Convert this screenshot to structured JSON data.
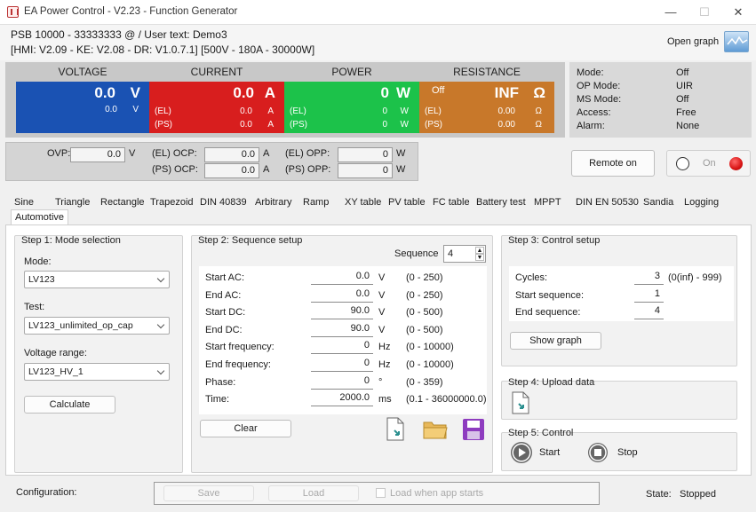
{
  "window": {
    "title": "EA Power Control - V2.23 - Function Generator",
    "minimize": "—",
    "maximize": "☐",
    "close": "✕"
  },
  "header": {
    "line1": "PSB 10000 - 33333333 @ / User text: Demo3",
    "line2": "[HMI: V2.09 - KE: V2.08 - DR: V1.0.7.1] [500V - 180A - 30000W]",
    "open_graph": "Open graph"
  },
  "meters": {
    "voltage": {
      "title": "VOLTAGE",
      "main": "0.0",
      "unit": "V",
      "sub": "0.0",
      "sub_unit": "V",
      "color": "#1a52b3"
    },
    "current": {
      "title": "CURRENT",
      "main": "0.0",
      "unit": "A",
      "el_label": "(EL)",
      "el_value": "0.0",
      "el_unit": "A",
      "ps_label": "(PS)",
      "ps_value": "0.0",
      "ps_unit": "A",
      "color": "#d81e1e"
    },
    "power": {
      "title": "POWER",
      "main": "0",
      "unit": "W",
      "el_label": "(EL)",
      "el_value": "0",
      "el_unit": "W",
      "ps_label": "(PS)",
      "ps_value": "0",
      "ps_unit": "W",
      "color": "#1cc24a"
    },
    "resistance": {
      "title": "RESISTANCE",
      "off": "Off",
      "main": "INF",
      "unit": "Ω",
      "el_label": "(EL)",
      "el_value": "0.00",
      "el_unit": "Ω",
      "ps_label": "(PS)",
      "ps_value": "0.00",
      "ps_unit": "Ω",
      "color": "#c8782a"
    }
  },
  "status_panel": [
    {
      "key": "Mode:",
      "value": "Off"
    },
    {
      "key": "OP Mode:",
      "value": "UIR"
    },
    {
      "key": "MS Mode:",
      "value": "Off"
    },
    {
      "key": "Access:",
      "value": "Free"
    },
    {
      "key": "Alarm:",
      "value": "None"
    }
  ],
  "protection": {
    "ovp_label": "OVP:",
    "ovp_value": "0.0",
    "ovp_unit": "V",
    "el_ocp_label": "(EL) OCP:",
    "el_ocp_value": "0.0",
    "el_ocp_unit": "A",
    "ps_ocp_label": "(PS) OCP:",
    "ps_ocp_value": "0.0",
    "ps_ocp_unit": "A",
    "el_opp_label": "(EL) OPP:",
    "el_opp_value": "0",
    "el_opp_unit": "W",
    "ps_opp_label": "(PS) OPP:",
    "ps_opp_value": "0",
    "ps_opp_unit": "W"
  },
  "remote_button": "Remote on",
  "output_toggle": {
    "label": "On",
    "indicator_color": "#e01c1c"
  },
  "tabs": [
    "Sine",
    "Triangle",
    "Rectangle",
    "Trapezoid",
    "DIN 40839",
    "Arbitrary",
    "Ramp",
    "XY table",
    "PV table",
    "FC table",
    "Battery test",
    "MPPT",
    "DIN EN 50530",
    "Sandia",
    "Logging",
    "Automotive"
  ],
  "step1": {
    "title": "Step 1: Mode selection",
    "mode_label": "Mode:",
    "mode_value": "LV123",
    "test_label": "Test:",
    "test_value": "LV123_unlimited_op_cap",
    "range_label": "Voltage range:",
    "range_value": "LV123_HV_1",
    "calculate": "Calculate"
  },
  "step2": {
    "title": "Step 2: Sequence setup",
    "sequence_label": "Sequence",
    "sequence_value": "4",
    "rows": [
      {
        "label": "Start AC:",
        "value": "0.0",
        "unit": "V",
        "range": "(0 - 250)"
      },
      {
        "label": "End AC:",
        "value": "0.0",
        "unit": "V",
        "range": "(0 - 250)"
      },
      {
        "label": "Start DC:",
        "value": "90.0",
        "unit": "V",
        "range": "(0 - 500)"
      },
      {
        "label": "End DC:",
        "value": "90.0",
        "unit": "V",
        "range": "(0 - 500)"
      },
      {
        "label": "Start frequency:",
        "value": "0",
        "unit": "Hz",
        "range": "(0 - 10000)"
      },
      {
        "label": "End frequency:",
        "value": "0",
        "unit": "Hz",
        "range": "(0 - 10000)"
      },
      {
        "label": "Phase:",
        "value": "0",
        "unit": "°",
        "range": "(0 - 359)"
      },
      {
        "label": "Time:",
        "value": "2000.0",
        "unit": "ms",
        "range": "(0.1 - 36000000.0)"
      }
    ],
    "clear": "Clear"
  },
  "step3": {
    "title": "Step 3: Control setup",
    "rows": [
      {
        "label": "Cycles:",
        "value": "3",
        "range": "(0(inf) - 999)"
      },
      {
        "label": "Start sequence:",
        "value": "1",
        "range": ""
      },
      {
        "label": "End sequence:",
        "value": "4",
        "range": ""
      }
    ],
    "show_graph": "Show graph"
  },
  "step4": {
    "title": "Step 4: Upload data"
  },
  "step5": {
    "title": "Step 5: Control",
    "start": "Start",
    "stop": "Stop"
  },
  "footer": {
    "configuration_label": "Configuration:",
    "save": "Save",
    "load": "Load",
    "load_when_starts": "Load when app starts",
    "state_label": "State:",
    "state_value": "Stopped"
  }
}
